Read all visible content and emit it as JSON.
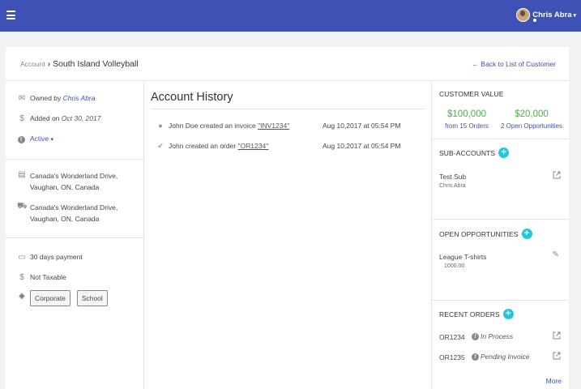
{
  "header": {
    "menu_icon": "hamburger-icon",
    "user_name": "Chris Abra",
    "user_caret": "▾"
  },
  "breadcrumb": {
    "root": "Account",
    "separator": "›",
    "current": "South Island Volleyball"
  },
  "back_link": "← Back to List of Customer",
  "owner": {
    "prefix": "Owned by ",
    "name": "Chris Abra"
  },
  "added": {
    "prefix": "Added on ",
    "date": "Oct 30, 2017"
  },
  "status": {
    "label": "Active",
    "caret": "▾"
  },
  "addresses": [
    {
      "icon": "document-icon",
      "line1": "Canada's Wonderland Drive,",
      "line2": "Vaughan, ON, Canada"
    },
    {
      "icon": "truck-icon",
      "line1": "Canada's Wonderland Drive,",
      "line2": "Vaughan, ON, Canada"
    }
  ],
  "payment_terms": "30 days payment",
  "tax_status": "Not Taxable",
  "tags": [
    "Corporate",
    "School"
  ],
  "history": {
    "title": "Account History",
    "items": [
      {
        "actor": "John Doe created an invoice ",
        "ref": "\"INV1234\"",
        "time": "Aug 10,2017 at 05:54 PM"
      },
      {
        "actor": "John created an order ",
        "ref": "\"OR1234\"",
        "time": "Aug 10,2017 at 05:54 PM"
      }
    ]
  },
  "customer_value": {
    "title": "CUSTOMER VALUE",
    "orders_amount": "$100,000",
    "orders_label": "from 15 Orders",
    "opps_amount": "$20,000",
    "opps_label": "2 Open Opportunities"
  },
  "sub_accounts": {
    "title": "SUB-ACCOUNTS",
    "items": [
      {
        "name": "Test Sub",
        "owner": "Chris Abra"
      }
    ]
  },
  "open_opportunities": {
    "title": "OPEN OPPORTUNITIES",
    "items": [
      {
        "name": "League T-shirts",
        "amount": "1000.00"
      }
    ]
  },
  "recent_orders": {
    "title": "RECENT ORDERS",
    "items": [
      {
        "id": "OR1234",
        "status": "In Process"
      },
      {
        "id": "OR1235",
        "status": "Pending Invoice"
      }
    ],
    "more": "More"
  },
  "colors": {
    "topbar": "#3f51b5",
    "link": "#3f51b5",
    "value_green": "#4caf50",
    "add_button": "#26c6da"
  }
}
